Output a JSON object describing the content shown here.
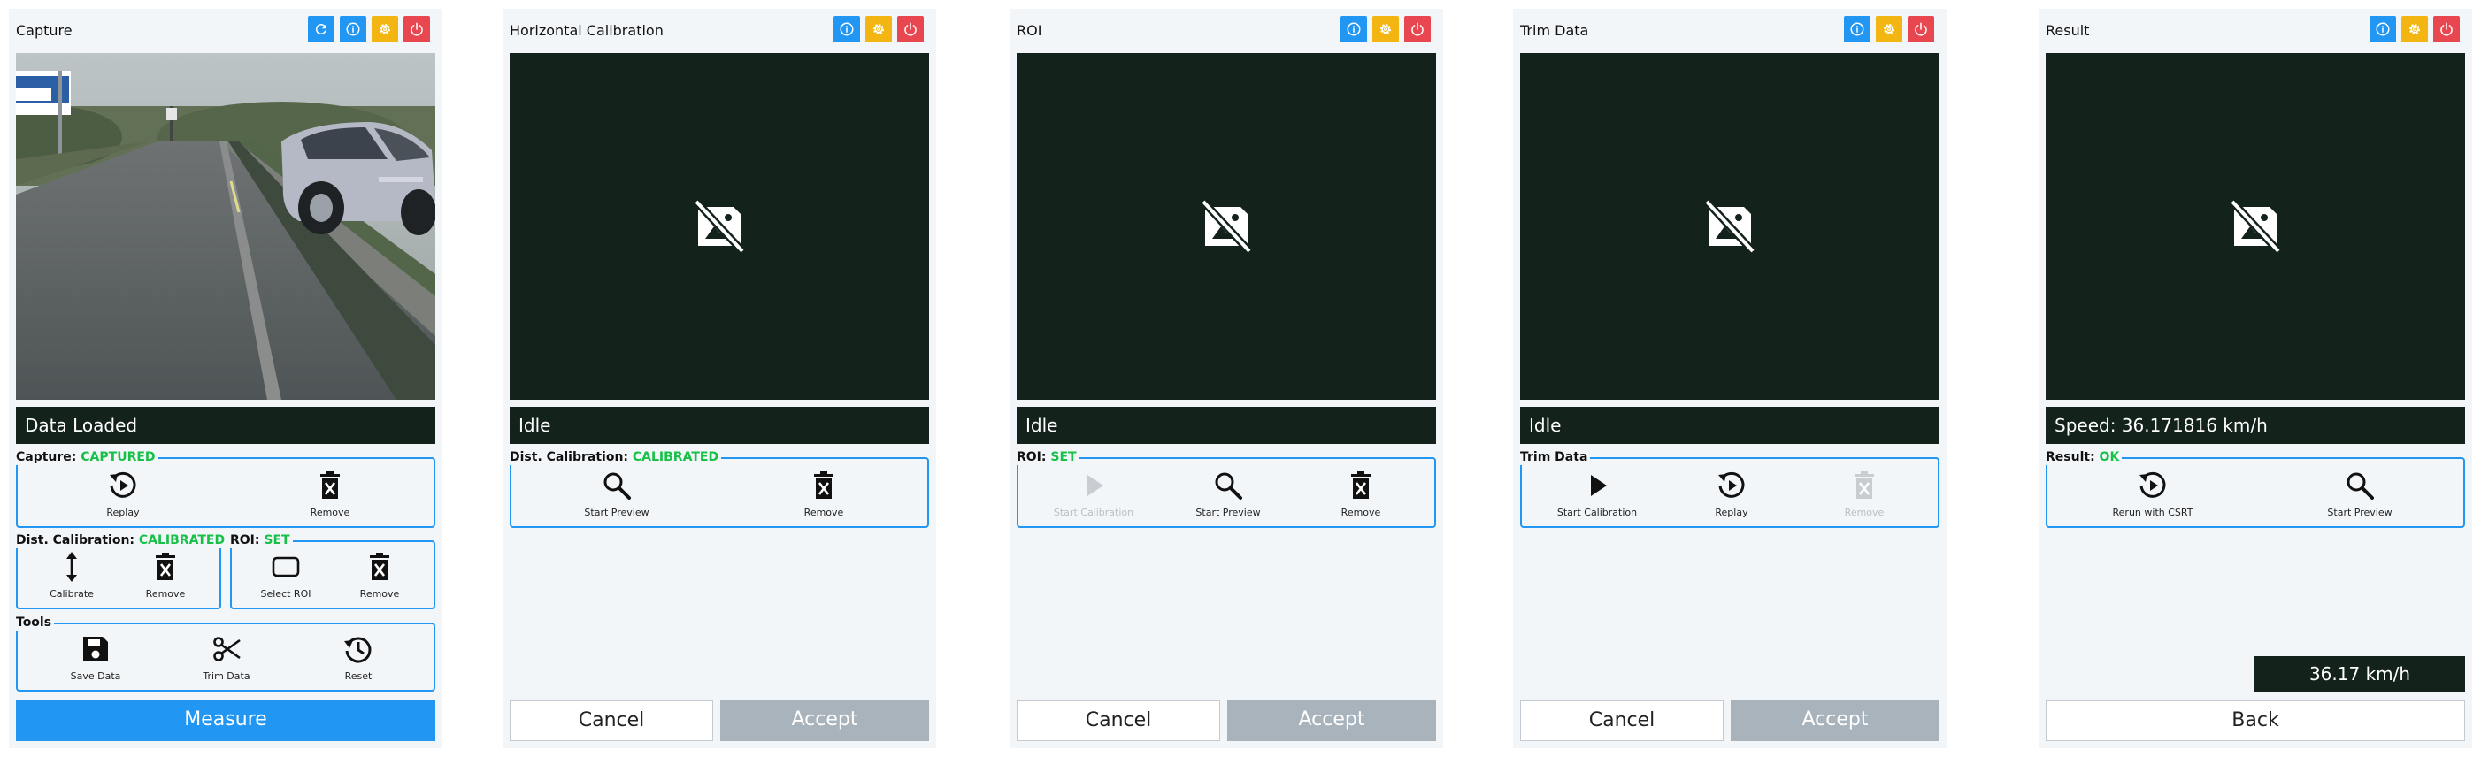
{
  "panels": [
    {
      "title": "Capture",
      "status": "Data Loaded",
      "groups": [
        {
          "label": "Capture:",
          "value": "CAPTURED",
          "buttons": [
            "Replay",
            "Remove"
          ]
        },
        {
          "label": "Dist. Calibration:",
          "value": "CALIBRATED",
          "buttons": [
            "Calibrate",
            "Remove"
          ]
        },
        {
          "label": "ROI:",
          "value": "SET",
          "buttons": [
            "Select ROI",
            "Remove"
          ]
        },
        {
          "label": "Tools",
          "value": "",
          "buttons": [
            "Save Data",
            "Trim Data",
            "Reset"
          ]
        }
      ],
      "primary_button": "Measure"
    },
    {
      "title": "Horizontal Calibration",
      "status": "Idle",
      "groups": [
        {
          "label": "Dist. Calibration:",
          "value": "CALIBRATED",
          "buttons": [
            "Start Preview",
            "Remove"
          ]
        }
      ],
      "cancel": "Cancel",
      "accept": "Accept"
    },
    {
      "title": "ROI",
      "status": "Idle",
      "groups": [
        {
          "label": "ROI:",
          "value": "SET",
          "buttons": [
            "Start Calibration",
            "Start Preview",
            "Remove"
          ],
          "disabled": [
            true,
            false,
            false
          ]
        }
      ],
      "cancel": "Cancel",
      "accept": "Accept"
    },
    {
      "title": "Trim Data",
      "status": "Idle",
      "groups": [
        {
          "label": "Trim Data",
          "value": "",
          "buttons": [
            "Start Calibration",
            "Replay",
            "Remove"
          ],
          "disabled": [
            false,
            false,
            true
          ]
        }
      ],
      "cancel": "Cancel",
      "accept": "Accept"
    },
    {
      "title": "Result",
      "status": "Speed: 36.171816 km/h",
      "groups": [
        {
          "label": "Result:",
          "value": "OK",
          "buttons": [
            "Rerun with CSRT",
            "Start Preview"
          ]
        }
      ],
      "speed_display": "36.17 km/h",
      "back": "Back"
    }
  ],
  "icons": {
    "titlebar": [
      "refresh-icon",
      "info-icon",
      "settings-icon",
      "power-icon"
    ],
    "placeholder": "no-image-icon"
  },
  "colors": {
    "accent": "#2196f3",
    "status_ok": "#17c046",
    "warning": "#f2b511",
    "danger": "#e8474f",
    "dark": "#13221b",
    "disabled": "#a9b3bc"
  }
}
